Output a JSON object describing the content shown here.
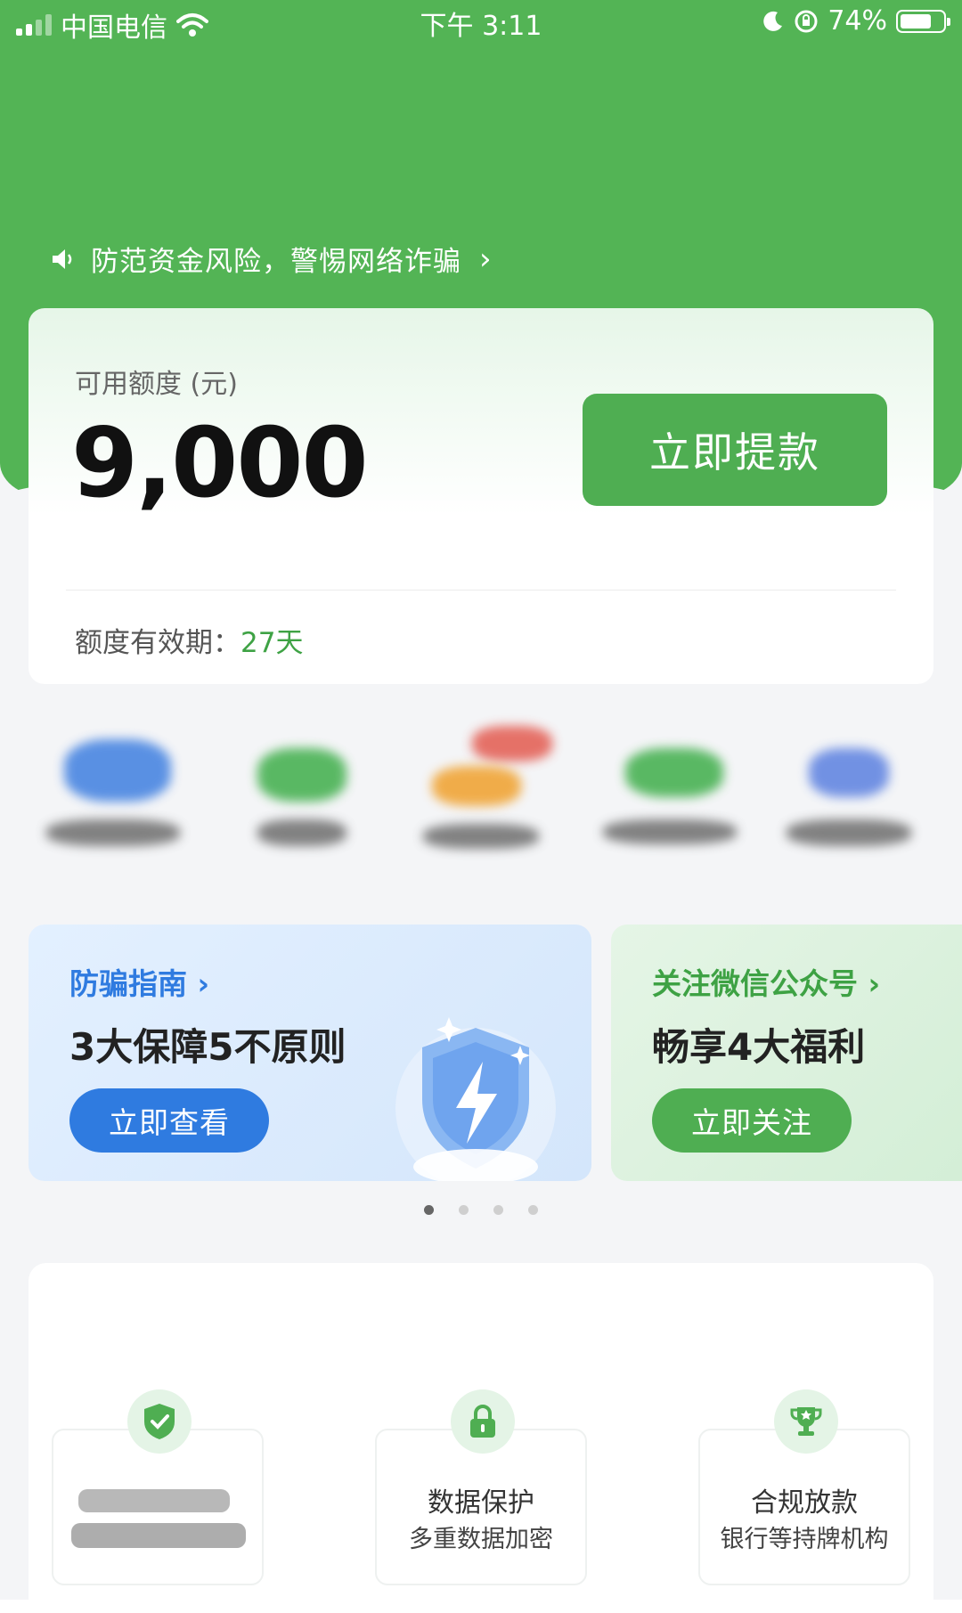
{
  "status_bar": {
    "carrier": "中国电信",
    "time": "下午 3:11",
    "battery": "74%",
    "battery_level": 0.74
  },
  "notice": {
    "text": "防范资金风险，警惕网络诈骗",
    "icon": "speaker-icon"
  },
  "credit": {
    "label": "可用额度 (元)",
    "amount": "9,000",
    "withdraw_label": "立即提款",
    "validity_label": "额度有效期：",
    "validity_value": "27天"
  },
  "banners": [
    {
      "title": "防骗指南 ›",
      "subtitle": "3大保障5不原则",
      "button": "立即查看"
    },
    {
      "title": "关注微信公众号 ›",
      "subtitle": "畅享4大福利",
      "button": "立即关注"
    }
  ],
  "carousel": {
    "page_count": 4,
    "active_index": 0
  },
  "features": [
    {
      "icon": "shield-check-icon",
      "title": "",
      "desc": ""
    },
    {
      "icon": "lock-icon",
      "title": "数据保护",
      "desc": "多重数据加密"
    },
    {
      "icon": "trophy-icon",
      "title": "合规放款",
      "desc": "银行等持牌机构"
    }
  ],
  "colors": {
    "brand_green": "#53b455",
    "button_green": "#4fae52",
    "accent_blue": "#2f7be0",
    "validity_green": "#3ea244"
  }
}
